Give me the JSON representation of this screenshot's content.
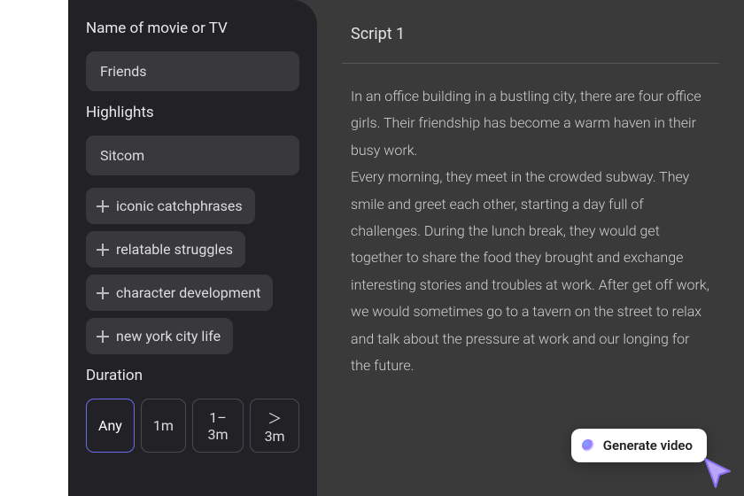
{
  "sidebar": {
    "name_label": "Name of movie or TV",
    "name_value": "Friends",
    "highlights_label": "Highlights",
    "highlight_primary": "Sitcom",
    "highlight_suggestions": [
      "iconic catchphrases",
      "relatable struggles",
      "character development",
      "new york city life"
    ],
    "duration_label": "Duration",
    "duration_options": [
      "Any",
      "1m",
      "1–3m",
      "＞3m"
    ],
    "duration_selected": "Any"
  },
  "main": {
    "script_title": "Script 1",
    "script_body": "In an office building in a bustling city, there are four office girls. Their friendship has become a warm haven in their busy work.\nEvery morning, they meet in the crowded subway. They smile and greet each other, starting a day full of challenges. During the lunch break, they would get together to share the food they brought and exchange interesting stories and troubles at work. After get off work, we would sometimes go to a tavern on the street to relax and talk about the pressure at work and our longing for the future."
  },
  "generate_button": {
    "label": "Generate video"
  }
}
